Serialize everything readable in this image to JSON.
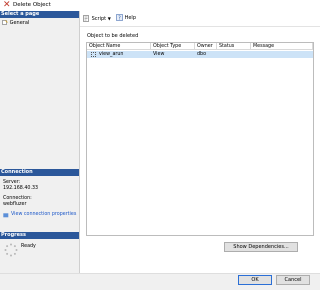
{
  "window": {
    "title": "Delete Object"
  },
  "sidebar": {
    "select_page_header": "Select a page",
    "pages": [
      {
        "label": "General"
      }
    ],
    "connection_header": "Connection",
    "server_label": "Server:",
    "server_value": "192.168.40.33",
    "connection_label": "Connection:",
    "connection_value": "webfluzer",
    "view_conn_link": "View connection properties",
    "progress_header": "Progress",
    "progress_status": "Ready"
  },
  "toolbar": {
    "script_label": "Script",
    "help_label": "Help"
  },
  "main": {
    "objects_label": "Object to be deleted",
    "columns": [
      "Object Name",
      "Object Type",
      "Owner",
      "Status",
      "Message"
    ],
    "rows": [
      {
        "name": "view_arun",
        "type": "View",
        "owner": "dbo",
        "status": "",
        "message": ""
      }
    ],
    "show_dependencies_label": "Show Dependencies..."
  },
  "footer": {
    "ok_label": "OK",
    "cancel_label": "Cancel"
  }
}
